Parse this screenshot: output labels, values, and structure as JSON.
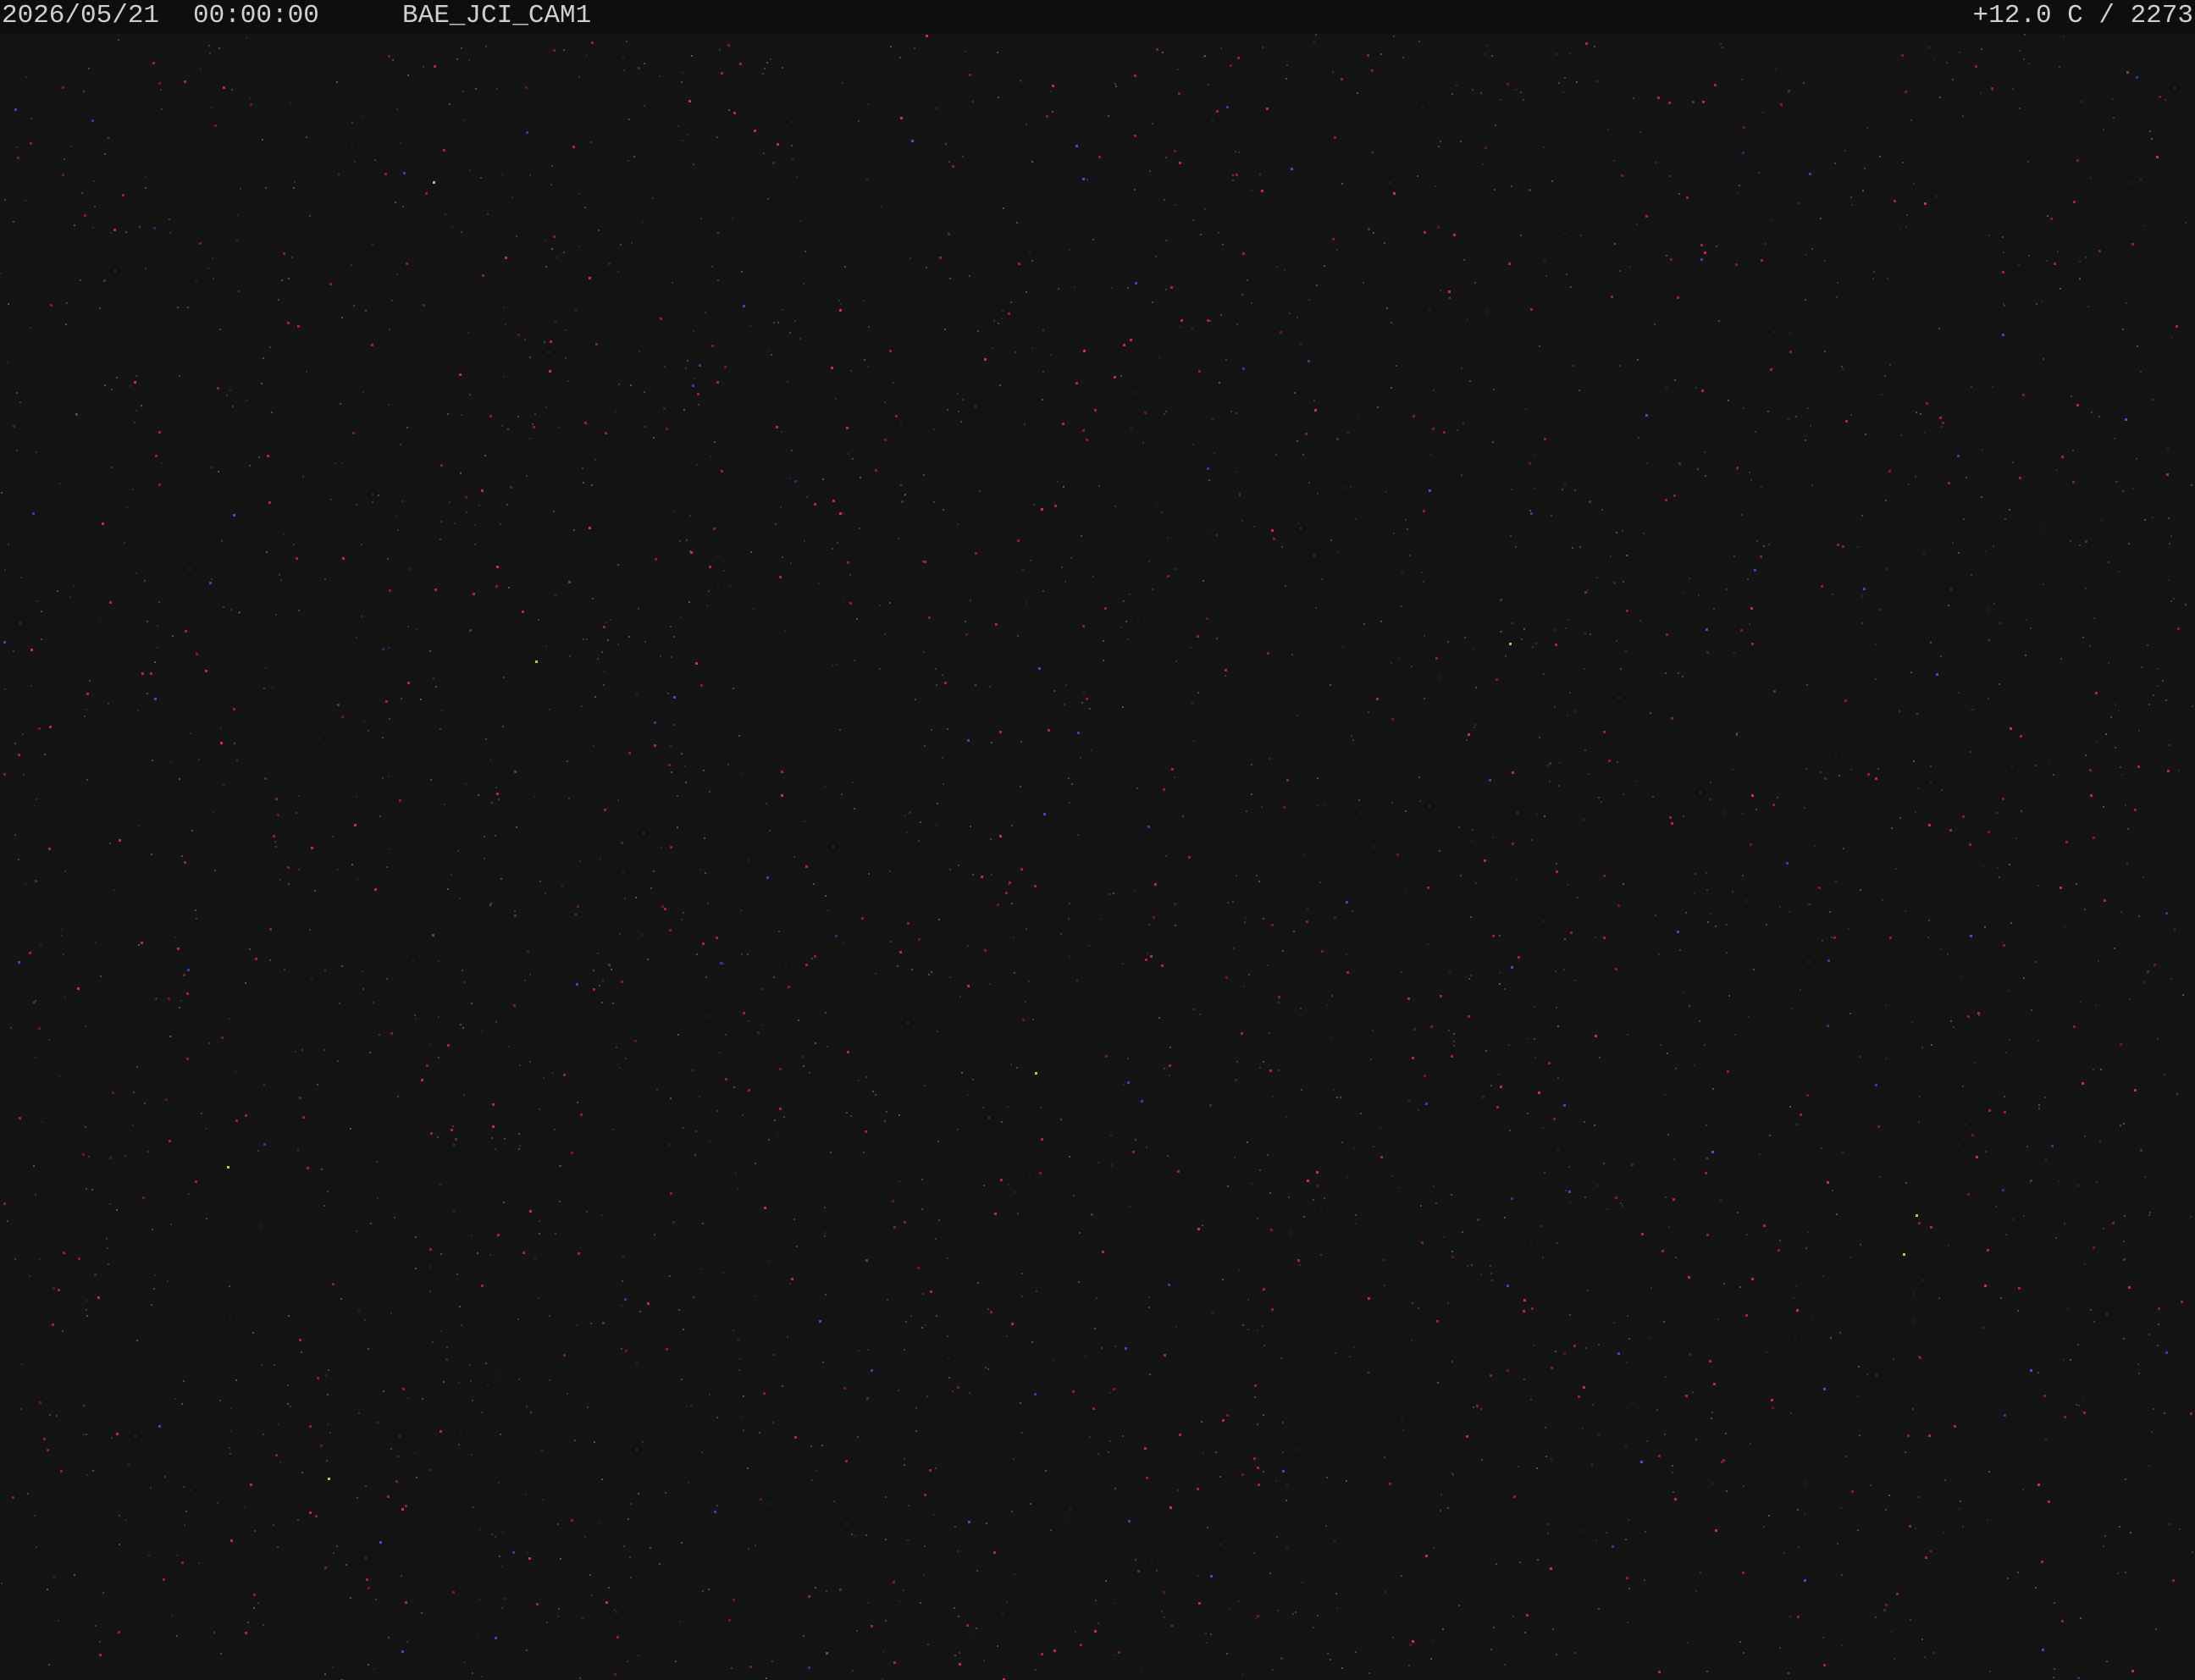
{
  "osd": {
    "date": "2026/05/21",
    "time": "00:00:00",
    "camera_name": "BAE_JCI_CAM1",
    "sensor_readout": "+12.0 C / 2273"
  },
  "scene": {
    "description_type": "night-sky-camera-frame",
    "background_color": "#141414",
    "noise_colors": [
      "#ff3050",
      "#d02040",
      "#5a5aff",
      "#7a7a7a",
      "#9a9a9a",
      "#c8ff60"
    ]
  }
}
